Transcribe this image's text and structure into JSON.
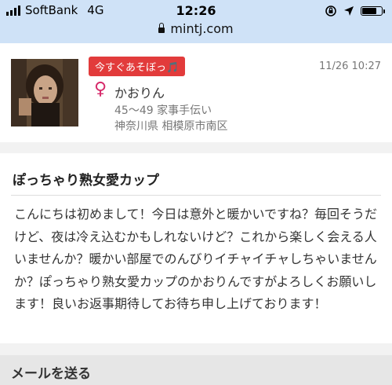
{
  "status_bar": {
    "carrier": "SoftBank",
    "network": "4G",
    "time": "12:26",
    "url": "mintj.com",
    "battery_level": 0.75
  },
  "profile": {
    "badge": "今すぐあそぼっ🎵",
    "timestamp": "11/26 10:27",
    "gender_symbol": "♀",
    "name": "かおりん",
    "age_job": "45〜49 家事手伝い",
    "location": "神奈川県 相模原市南区"
  },
  "message": {
    "title": "ぽっちゃり熟女愛カップ",
    "body": "こんにちは初めまして！今日は意外と暖かいですね？毎回そうだけど、夜は冷え込むかもしれないけど？これから楽しく会える人いませんか？暖かい部屋でのんびりイチャイチャしちゃいませんか？ぽっちゃり熟女愛カップのかおりんですがよろしくお願いします！良いお返事期待してお待ち申し上げております！"
  },
  "actions": {
    "send_mail_label": "メールを送る"
  },
  "colors": {
    "status_bar_bg": "#cfe2f7",
    "badge_bg": "#e23b3b",
    "gender_color": "#d62a6a"
  },
  "icons": [
    "signal-icon",
    "lock-icon",
    "orientation-lock-icon",
    "location-arrow-icon",
    "battery-icon",
    "female-icon"
  ]
}
